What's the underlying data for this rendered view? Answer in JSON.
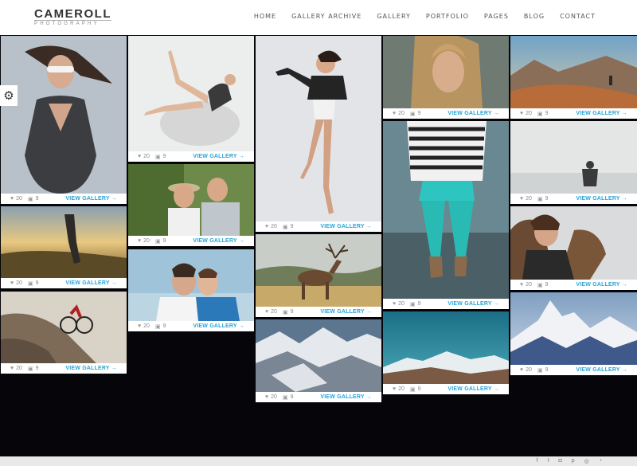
{
  "header": {
    "logo_main": "CAMEROLL",
    "logo_sub": "PHOTOGRAPHY",
    "nav": [
      "HOME",
      "GALLERY ARCHIVE",
      "GALLERY",
      "PORTFOLIO",
      "PAGES",
      "BLOG",
      "CONTACT"
    ]
  },
  "tile_meta": {
    "likes": "20",
    "images": "9",
    "view_gallery": "VIEW GALLERY →"
  },
  "icons": {
    "like": "heart-icon",
    "images": "image-icon",
    "settings": "gears-icon"
  },
  "colors": {
    "accent": "#2aa3d6",
    "background": "#05050a"
  }
}
